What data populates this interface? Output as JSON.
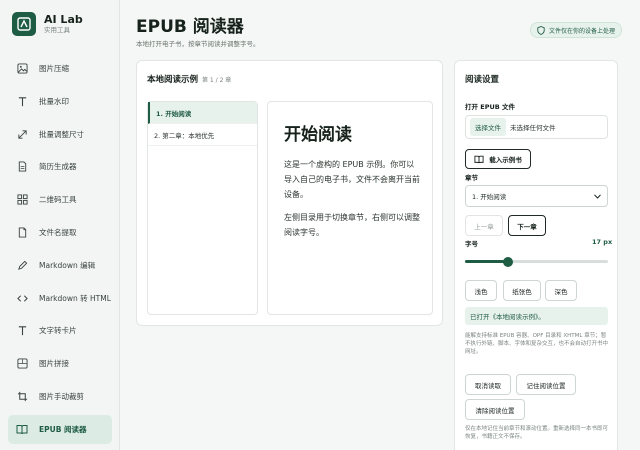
{
  "brand": {
    "name": "AI Lab",
    "subtitle": "实用工具"
  },
  "nav": [
    {
      "label": "图片压缩",
      "icon": "image-icon"
    },
    {
      "label": "批量水印",
      "icon": "text-icon"
    },
    {
      "label": "批量调整尺寸",
      "icon": "resize-icon"
    },
    {
      "label": "简历生成器",
      "icon": "document-icon"
    },
    {
      "label": "二维码工具",
      "icon": "grid-icon"
    },
    {
      "label": "文件名提取",
      "icon": "file-icon"
    },
    {
      "label": "Markdown 编辑",
      "icon": "pen-icon"
    },
    {
      "label": "Markdown 转 HTML",
      "icon": "code-icon"
    },
    {
      "label": "文字转卡片",
      "icon": "text-icon"
    },
    {
      "label": "图片拼接",
      "icon": "image-icon"
    },
    {
      "label": "图片手动裁剪",
      "icon": "crop-icon"
    },
    {
      "label": "EPUB 阅读器",
      "icon": "book-icon",
      "active": true
    }
  ],
  "header": {
    "title": "EPUB 阅读器",
    "subtitle": "本地打开电子书，按章节阅读并调整字号。",
    "privacy": "文件仅在你的设备上处理"
  },
  "reader": {
    "title": "本地阅读示例",
    "chapter_count": "第 1 / 2 章",
    "toc": [
      "1. 开始阅读",
      "2. 第二章：本地优先"
    ],
    "content_title": "开始阅读",
    "paragraphs": [
      "这是一个虚构的 EPUB 示例。你可以导入自己的电子书，文件不会离开当前设备。",
      "左侧目录用于切换章节，右侧可以调整阅读字号。"
    ]
  },
  "settings": {
    "title": "阅读设置",
    "open_label": "打开 EPUB 文件",
    "choose_file": "选择文件",
    "no_file": "未选择任何文件",
    "load_sample": "载入示例书",
    "chapter_label": "章节",
    "chapter_selected": "1. 开始阅读",
    "prev": "上一章",
    "next": "下一章",
    "font_label": "字号",
    "font_value": "17 px",
    "font_progress": 0.3,
    "themes": [
      "浅色",
      "纸张色",
      "深色"
    ],
    "status": "已打开《本地阅读示例》。",
    "note1": "能解支持标准 EPUB 容器、OPF 目录和 XHTML 章节；暂不执行外链、脚本、字体和复杂交互，也不会自动打开书中网址。",
    "cancel_load": "取消读取",
    "remember_pos": "记住阅读位置",
    "clear_pos": "清除阅读位置",
    "note2": "仅在本地记住当前章节和滚动位置。重新选择同一本书即可恢复，书籍正文不保存。"
  },
  "colors": {
    "accent": "#1f5c44",
    "accent_light": "#e8f2ed"
  }
}
